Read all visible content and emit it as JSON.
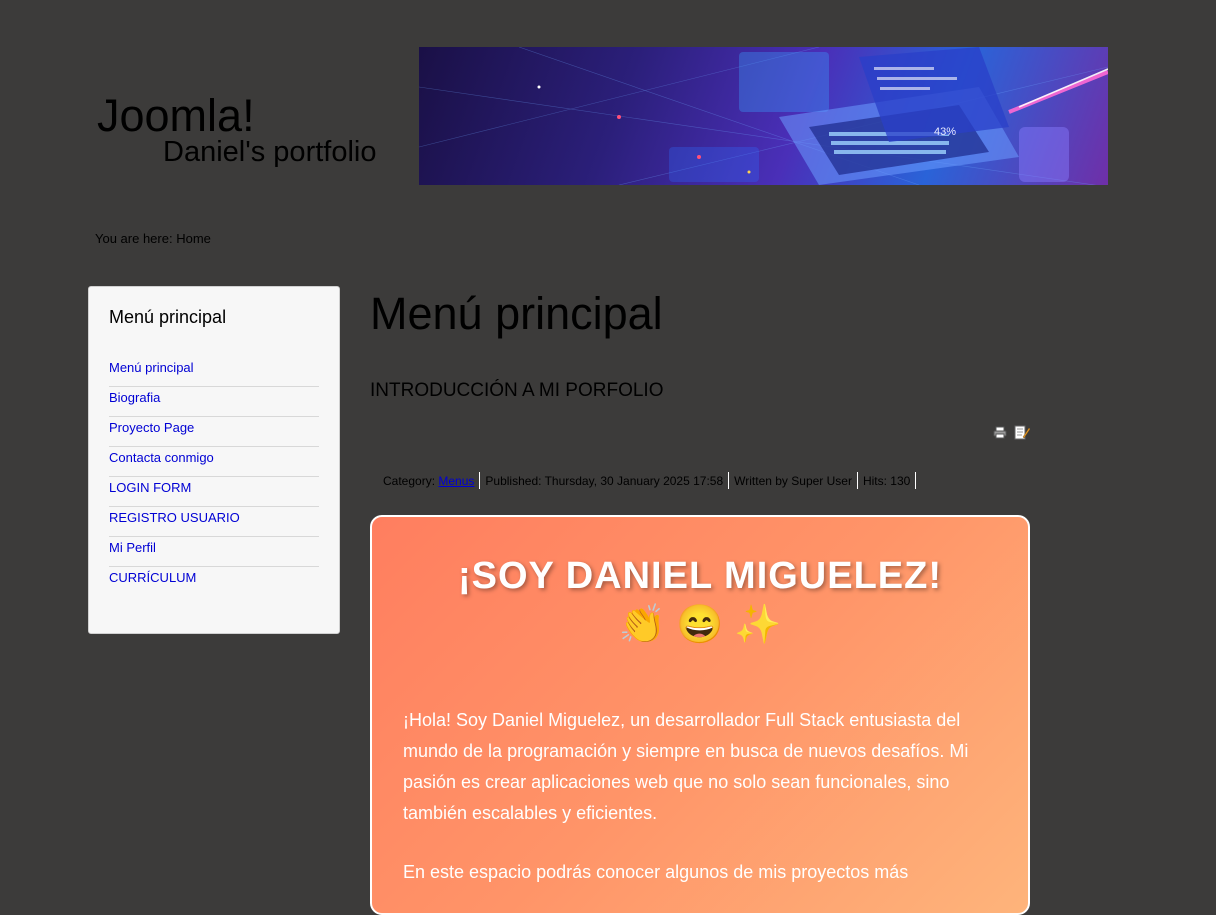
{
  "header": {
    "site_title": "Joomla!",
    "site_subtitle": "Daniel's portfolio"
  },
  "breadcrumb": {
    "prefix": "You are here:",
    "current": "Home"
  },
  "sidebar": {
    "title": "Menú principal",
    "items": [
      {
        "label": "Menú principal"
      },
      {
        "label": "Biografia"
      },
      {
        "label": "Proyecto Page"
      },
      {
        "label": "Contacta conmigo"
      },
      {
        "label": "LOGIN FORM"
      },
      {
        "label": "REGISTRO USUARIO"
      },
      {
        "label": "Mi Perfil"
      },
      {
        "label": "CURRÍCULUM"
      }
    ]
  },
  "main": {
    "page_title": "Menú principal",
    "article_title": "INTRODUCCIÓN A MI PORFOLIO",
    "icons": [
      "print-icon",
      "edit-icon"
    ],
    "meta": {
      "category_label": "Category:",
      "category_link": "Menus",
      "published": "Published: Thursday, 30 January 2025 17:58",
      "author": "Written by Super User",
      "hits": "Hits: 130"
    },
    "card": {
      "heading": "¡SOY DANIEL MIGUELEZ!",
      "emojis": "👏 😄 ✨",
      "paragraph1": "¡Hola! Soy Daniel Miguelez, un desarrollador Full Stack entusiasta del mundo de la programación y siempre en busca de nuevos desafíos. Mi pasión es crear aplicaciones web que no solo sean funcionales, sino también escalables y eficientes.",
      "paragraph2": "En este espacio podrás conocer algunos de mis proyectos más",
      "gradient_start": "#ff7e5f",
      "gradient_end": "#feb47b"
    }
  },
  "colors": {
    "page_bg": "#3c3b3a",
    "link": "#0000d4",
    "sidebar_bg": "#f7f7f7"
  }
}
